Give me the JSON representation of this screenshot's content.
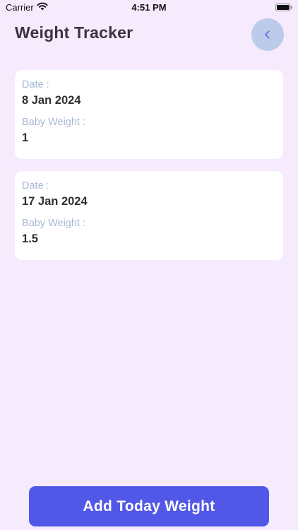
{
  "status_bar": {
    "carrier": "Carrier",
    "time": "4:51 PM"
  },
  "header": {
    "title": "Weight Tracker",
    "back_icon": "chevron-left-icon"
  },
  "entries": [
    {
      "date_label": "Date :",
      "date": "8 Jan 2024",
      "weight_label": "Baby Weight :",
      "weight": "1"
    },
    {
      "date_label": "Date :",
      "date": "17 Jan 2024",
      "weight_label": "Baby Weight :",
      "weight": "1.5"
    }
  ],
  "footer": {
    "add_button_label": "Add Today Weight"
  },
  "colors": {
    "background": "#f6eafd",
    "card": "#ffffff",
    "accent": "#5158e8",
    "back_button": "#bccbe9",
    "label": "#a7b8d6"
  }
}
